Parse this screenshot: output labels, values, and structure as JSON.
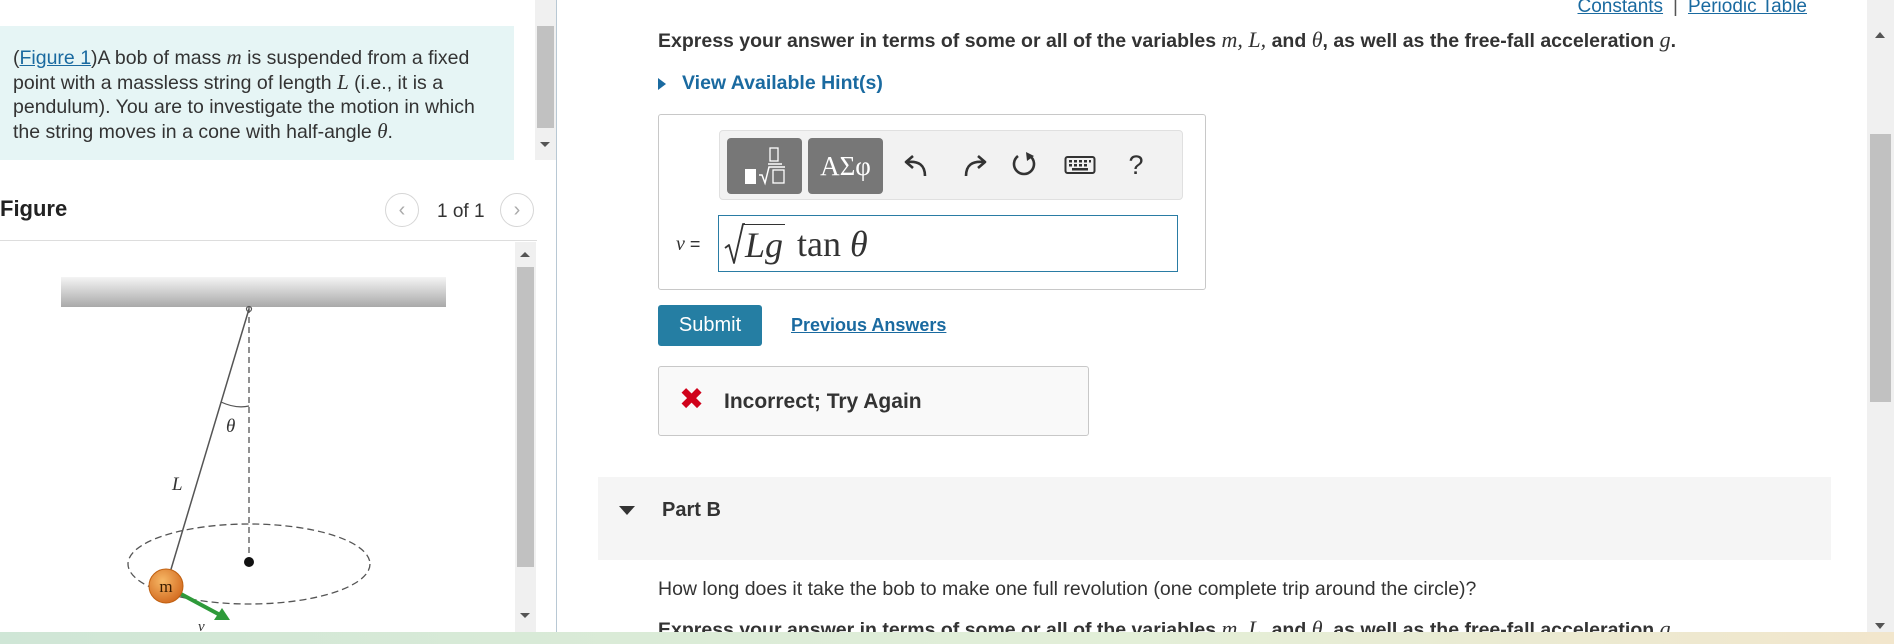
{
  "problem": {
    "figure_link": "Figure 1",
    "text_pre": ")A bob of mass ",
    "var_m": "m",
    "text_mid1": " is suspended from a fixed point with a massless string of length ",
    "var_L": "L",
    "text_mid2": " (i.e., it is a pendulum). You are to investigate the motion in which the string moves in a cone with half-angle ",
    "var_theta": "θ",
    "text_end": "."
  },
  "figure": {
    "title": "Figure",
    "pager": "1 of 1",
    "label_L": "L",
    "label_theta": "θ",
    "label_m": "m",
    "label_v": "v⃗"
  },
  "header_links": {
    "constants": "Constants",
    "separator": "|",
    "periodic_table": "Periodic Table"
  },
  "part_a": {
    "instruction": {
      "prefix": "Express your answer in terms of some or all of the variables ",
      "vars": "m, L,",
      "and": " and ",
      "theta": "θ",
      "middle": ", as well as the free-fall acceleration ",
      "g": "g",
      "end": "."
    },
    "hint": "View Available Hint(s)",
    "toolbar": {
      "templates_icon": "templates-icon",
      "symbols": "ΑΣφ",
      "help": "?"
    },
    "answer_label_var": "v",
    "answer_label_eq": " =",
    "answer": {
      "radicand": "Lg",
      "func": "tan",
      "arg": "θ"
    },
    "submit": "Submit",
    "previous_answers": "Previous Answers",
    "feedback": "Incorrect; Try Again"
  },
  "part_b": {
    "title": "Part B",
    "question": "How long does it take the bob to make one full revolution (one complete trip around the circle)?",
    "instruction": {
      "prefix": "Express your answer in terms of some or all of the variables ",
      "vars": "m, L,",
      "and": " and ",
      "theta": "θ",
      "middle": ", as well as the free-fall acceleration ",
      "g": "g",
      "end": "."
    }
  },
  "colors": {
    "accent": "#257ea3",
    "link": "#1a6aa0",
    "error": "#d0021b",
    "problem_bg": "#e6f5f5",
    "bob": "#e07a1f",
    "velocity_arrow": "#2e9a3a"
  }
}
